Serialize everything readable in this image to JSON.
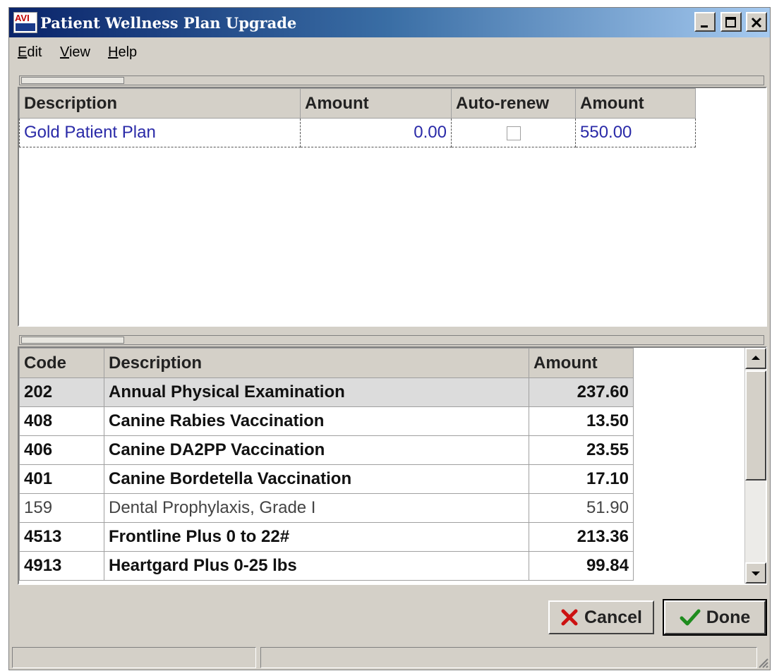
{
  "window": {
    "title": "Patient Wellness Plan Upgrade",
    "logo_text": "AVI"
  },
  "menu": {
    "items": [
      {
        "label": "Edit",
        "underline": "E",
        "rest": "dit"
      },
      {
        "label": "View",
        "underline": "V",
        "rest": "iew"
      },
      {
        "label": "Help",
        "underline": "H",
        "rest": "elp"
      }
    ]
  },
  "plan_table": {
    "columns": [
      "Description",
      "Amount",
      "Auto-renew",
      "Amount"
    ],
    "rows": [
      {
        "description": "Gold Patient Plan",
        "amount": "0.00",
        "auto_renew": false,
        "amount2": "550.00"
      }
    ]
  },
  "service_table": {
    "columns": [
      "Code",
      "Description",
      "Amount"
    ],
    "rows": [
      {
        "code": "202",
        "description": "Annual Physical Examination",
        "amount": "237.60"
      },
      {
        "code": "408",
        "description": "Canine Rabies Vaccination",
        "amount": "13.50"
      },
      {
        "code": "406",
        "description": "Canine DA2PP Vaccination",
        "amount": "23.55"
      },
      {
        "code": "401",
        "description": "Canine Bordetella Vaccination",
        "amount": "17.10"
      },
      {
        "code": "159",
        "description": "Dental Prophylaxis, Grade I",
        "amount": "51.90"
      },
      {
        "code": "4513",
        "description": "Frontline Plus 0 to 22#",
        "amount": "213.36"
      },
      {
        "code": "4913",
        "description": "Heartgard Plus 0-25 lbs",
        "amount": "99.84"
      }
    ]
  },
  "buttons": {
    "cancel": "Cancel",
    "done": "Done"
  },
  "icons": {
    "cancel": "red-x-icon",
    "done": "green-check-icon"
  },
  "colors": {
    "plan_text": "#2a2aa8",
    "cancel_icon": "#cc1111",
    "done_icon": "#1e8c1e"
  }
}
